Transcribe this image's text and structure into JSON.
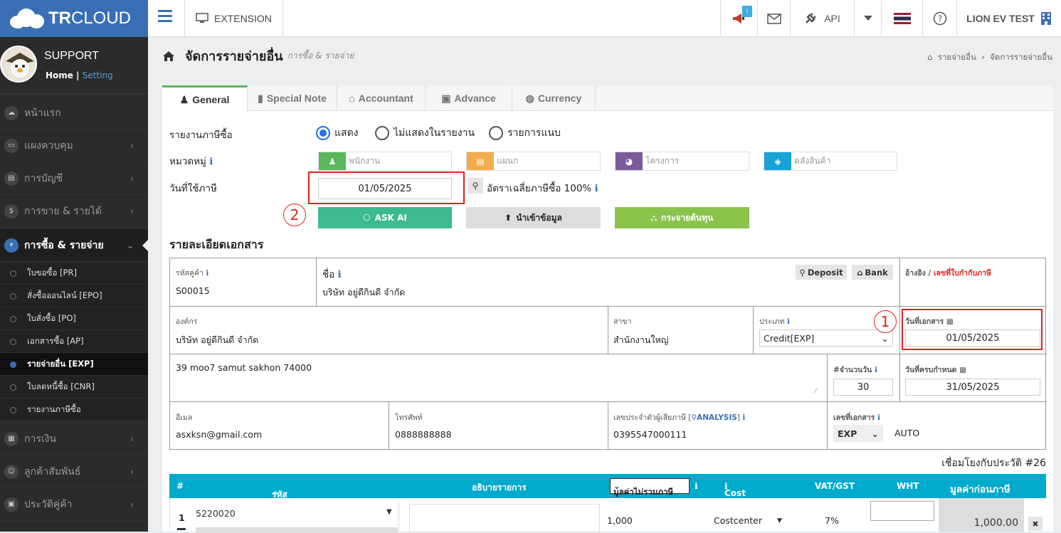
{
  "brand": {
    "bold": "TR",
    "rest": "CLOUD"
  },
  "top": {
    "extension": "EXTENSION",
    "api": "API",
    "company": "LION EV TEST",
    "badge": "!"
  },
  "user": {
    "name": "SUPPORT",
    "home": "Home",
    "setting": "Setting"
  },
  "menu": [
    {
      "label": "หน้าแรก"
    },
    {
      "label": "แผงควบคุม"
    },
    {
      "label": "การบัญชี"
    },
    {
      "label": "การขาย & รายได้"
    },
    {
      "label": "การซื้อ & รายจ่าย"
    },
    {
      "label": "การเงิน"
    },
    {
      "label": "ลูกค้าสัมพันธ์"
    },
    {
      "label": "ประวัติคู่ค้า"
    }
  ],
  "submenu": [
    {
      "label": "ใบขอซื้อ [PR]"
    },
    {
      "label": "สั่งซื้อออนไลน์ [EPO]"
    },
    {
      "label": "ใบสั่งซื้อ [PO]"
    },
    {
      "label": "เอกสารซื้อ [AP]"
    },
    {
      "label": "รายจ่ายอื่น [EXP]"
    },
    {
      "label": "ใบลดหนี้ซื้อ [CNR]"
    },
    {
      "label": "รายงานภาษีซื้อ"
    }
  ],
  "page": {
    "title": "จัดการรายจ่ายอื่น",
    "subtitle": "การซื้อ & รายจ่าย",
    "bc1": "รายจ่ายอื่น",
    "bc2": "จัดการรายจ่ายอื่น"
  },
  "tabs": [
    "General",
    "Special Note",
    "Accountant",
    "Advance",
    "Currency"
  ],
  "form": {
    "tax_report_label": "รายงานภาษีซื้อ",
    "radio": [
      "แสดง",
      "ไม่แสดงในรายงาน",
      "รายการแนบ"
    ],
    "category_label": "หมวดหมู่",
    "employee_ph": "พนักงาน",
    "dept_ph": "แผนก",
    "project_ph": "โครงการ",
    "warehouse_ph": "คลังสินค้า",
    "tax_date_label": "วันที่ใช้ภาษี",
    "tax_date": "01/05/2025",
    "avg_rate": "อัตราเฉลี่ยภาษีซื้อ 100%",
    "ask_ai": "ASK AI",
    "import": "นำเข้าข้อมูล",
    "distribute": "กระจายต้นทุน"
  },
  "doc": {
    "section": "รายละเอียดเอกสาร",
    "vendor_code_label": "รหัสคู่ค้า",
    "vendor_code": "S00015",
    "name_label": "ชื่อ",
    "name": "บริษัท อยู่ดีกินดี จำกัด",
    "deposit": "Deposit",
    "bank": "Bank",
    "ref_label": "อ้างอิง /",
    "ref_red": "เลขที่ใบกำกับภาษี",
    "org_label": "องค์กร",
    "org": "บริษัท อยู่ดีกินดี จำกัด",
    "branch_label": "สาขา",
    "branch": "สำนักงานใหญ่",
    "type_label": "ประเภท",
    "type": "Credit[EXP]",
    "doc_date_label": "วันที่เอกสาร",
    "doc_date": "01/05/2025",
    "address": "39 moo7 samut sakhon 74000",
    "days_label": "#จำนวนวัน",
    "days": "30",
    "due_label": "วันที่ครบกำหนด",
    "due": "31/05/2025",
    "email_label": "อีเมล",
    "email": "asxksn@gmail.com",
    "phone_label": "โทรศัพท์",
    "phone": "0888888888",
    "taxid_label": "เลขประจำตัวผู้เสียภาษี [",
    "taxid_analysis": "ANALYSIS",
    "taxid_close": "]",
    "taxid": "0395547000111",
    "docno_label": "เลขที่เอกสาร",
    "docno_prefix": "EXP",
    "docno_auto": "AUTO",
    "link": "เชื่อมโยงกับประวัติ #26"
  },
  "table": {
    "headers": [
      "#",
      "รหัสบัญชี",
      "อธิบายรายการ",
      "มูลค่าไม่รวมภาษี",
      "Cost Center",
      "VAT/GST",
      "WHT",
      "มูลค่าก่อนภาษี"
    ],
    "row": {
      "no": "1",
      "account": "5220020",
      "qty": "1,000",
      "cc": "Costcenter",
      "vat": "7%",
      "amount": "1,000.00",
      "del": "✖"
    }
  },
  "annotations": [
    "1",
    "2"
  ]
}
